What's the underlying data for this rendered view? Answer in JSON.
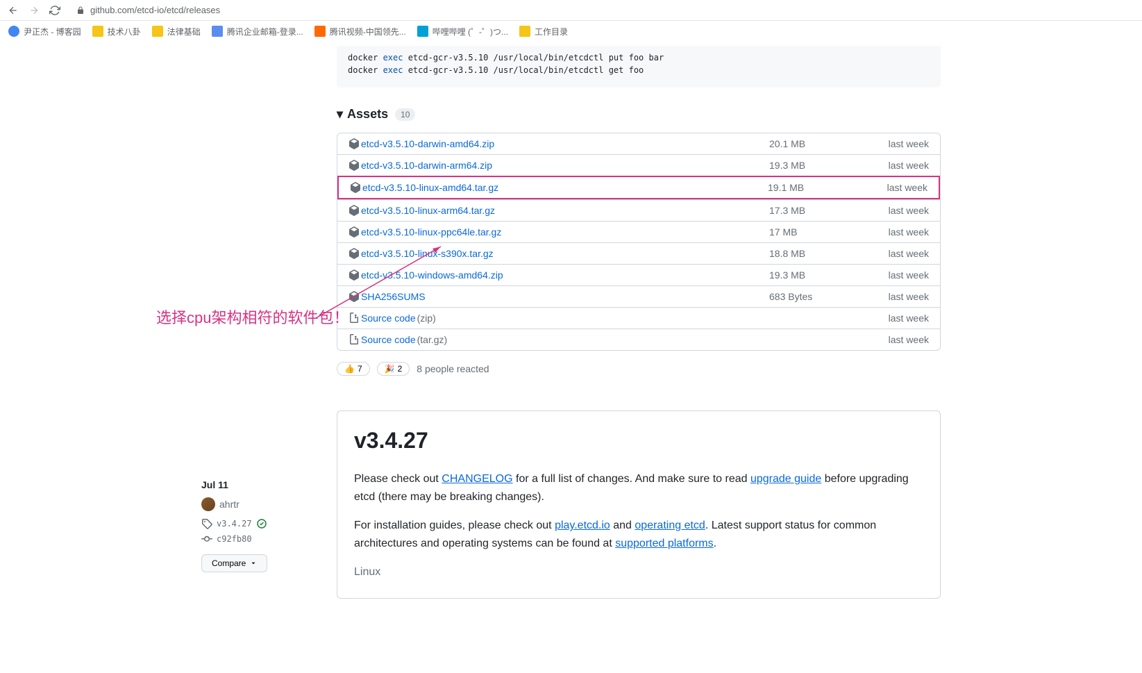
{
  "browser": {
    "url": "github.com/etcd-io/etcd/releases"
  },
  "bookmarks": [
    {
      "icon": "person",
      "label": "尹正杰 - 博客园"
    },
    {
      "icon": "folder",
      "label": "技术八卦"
    },
    {
      "icon": "folder",
      "label": "法律基础"
    },
    {
      "icon": "infinity",
      "label": "腾讯企业邮箱-登录..."
    },
    {
      "icon": "play",
      "label": "腾讯视频-中国领先..."
    },
    {
      "icon": "tv",
      "label": "哔哩哔哩 (゜-゜)つ..."
    },
    {
      "icon": "folder",
      "label": "工作目录"
    }
  ],
  "codeblock": {
    "line1_prefix": "docker ",
    "line1_kw": "exec",
    "line1_rest": " etcd-gcr-v3.5.10 /usr/local/bin/etcdctl put foo bar",
    "line2_prefix": "docker ",
    "line2_kw": "exec",
    "line2_rest": " etcd-gcr-v3.5.10 /usr/local/bin/etcdctl get foo"
  },
  "assets": {
    "title": "Assets",
    "count": "10",
    "items": [
      {
        "name": "etcd-v3.5.10-darwin-amd64.zip",
        "size": "20.1 MB",
        "date": "last week",
        "icon": "cube"
      },
      {
        "name": "etcd-v3.5.10-darwin-arm64.zip",
        "size": "19.3 MB",
        "date": "last week",
        "icon": "cube"
      },
      {
        "name": "etcd-v3.5.10-linux-amd64.tar.gz",
        "size": "19.1 MB",
        "date": "last week",
        "icon": "cube",
        "highlighted": true
      },
      {
        "name": "etcd-v3.5.10-linux-arm64.tar.gz",
        "size": "17.3 MB",
        "date": "last week",
        "icon": "cube"
      },
      {
        "name": "etcd-v3.5.10-linux-ppc64le.tar.gz",
        "size": "17 MB",
        "date": "last week",
        "icon": "cube"
      },
      {
        "name": "etcd-v3.5.10-linux-s390x.tar.gz",
        "size": "18.8 MB",
        "date": "last week",
        "icon": "cube"
      },
      {
        "name": "etcd-v3.5.10-windows-amd64.zip",
        "size": "19.3 MB",
        "date": "last week",
        "icon": "cube"
      },
      {
        "name": "SHA256SUMS",
        "size": "683 Bytes",
        "date": "last week",
        "icon": "cube"
      },
      {
        "name": "Source code",
        "secondary": "(zip)",
        "size": "",
        "date": "last week",
        "icon": "zip"
      },
      {
        "name": "Source code",
        "secondary": "(tar.gz)",
        "size": "",
        "date": "last week",
        "icon": "zip"
      }
    ]
  },
  "reactions": {
    "thumbsup": "7",
    "tada": "2",
    "text": "8 people reacted"
  },
  "annotation": "选择cpu架构相符的软件包！",
  "release2": {
    "date": "Jul 11",
    "author": "ahrtr",
    "tag": "v3.4.27",
    "commit": "c92fb80",
    "compare": "Compare",
    "title": "v3.4.27",
    "body_p1_pre": "Please check out ",
    "body_p1_link1": "CHANGELOG",
    "body_p1_mid": " for a full list of changes. And make sure to read ",
    "body_p1_link2": "upgrade guide",
    "body_p1_end": " before upgrading etcd (there may be breaking changes).",
    "body_p2_pre": "For installation guides, please check out ",
    "body_p2_link1": "play.etcd.io",
    "body_p2_mid1": " and ",
    "body_p2_link2": "operating etcd",
    "body_p2_mid2": ". Latest support status for common architectures and operating systems can be found at ",
    "body_p2_link3": "supported platforms",
    "body_p2_end": ".",
    "linux": "Linux"
  }
}
